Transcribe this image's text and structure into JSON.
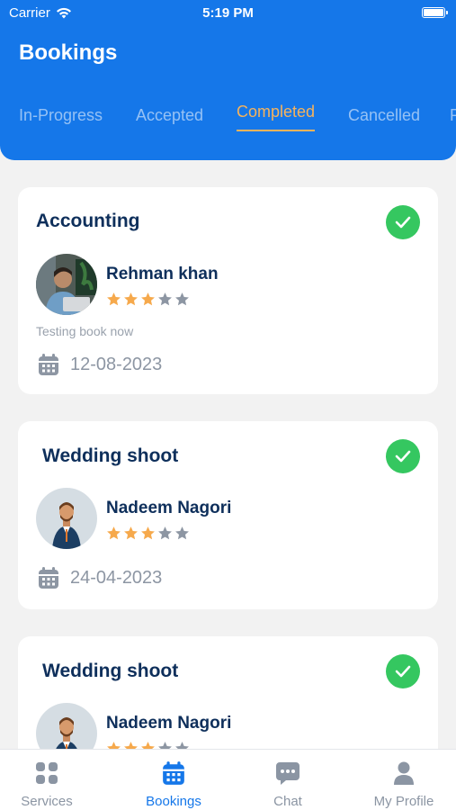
{
  "status_bar": {
    "carrier": "Carrier",
    "time": "5:19 PM"
  },
  "header": {
    "title": "Bookings"
  },
  "tabs": [
    {
      "label": "In-Progress",
      "active": false
    },
    {
      "label": "Accepted",
      "active": false
    },
    {
      "label": "Completed",
      "active": true
    },
    {
      "label": "Cancelled",
      "active": false
    },
    {
      "label": "P",
      "active": false
    }
  ],
  "bookings": [
    {
      "service": "Accounting",
      "provider": "Rehman khan",
      "rating": 3,
      "rating_max": 5,
      "note": "Testing book now",
      "date": "12-08-2023"
    },
    {
      "service": "Wedding shoot",
      "provider": "Nadeem Nagori",
      "rating": 3,
      "rating_max": 5,
      "date": "24-04-2023"
    },
    {
      "service": "Wedding shoot",
      "provider": "Nadeem Nagori",
      "rating": 3,
      "rating_max": 5
    }
  ],
  "bottom_nav": [
    {
      "label": "Services",
      "icon": "grid-icon",
      "active": false
    },
    {
      "label": "Bookings",
      "icon": "calendar-icon",
      "active": true
    },
    {
      "label": "Chat",
      "icon": "chat-icon",
      "active": false
    },
    {
      "label": "My Profile",
      "icon": "user-icon",
      "active": false
    }
  ],
  "colors": {
    "primary": "#1577e9",
    "accent": "#f6b35c",
    "success": "#35c760",
    "title_text": "#0e2f5b",
    "star_filled": "#f6a94c",
    "star_empty": "#8d96a3"
  }
}
